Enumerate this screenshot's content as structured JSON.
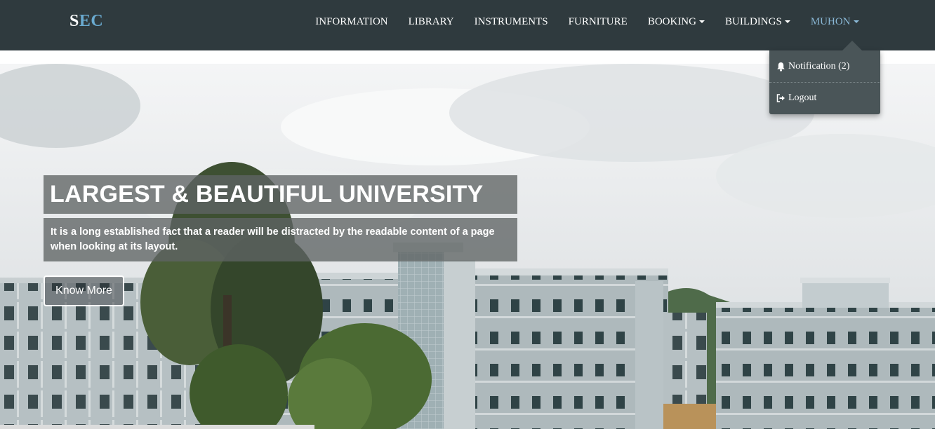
{
  "brand": {
    "part1": "S",
    "part2": "EC"
  },
  "nav": {
    "items": [
      {
        "label": "INFORMATION",
        "dropdown": false
      },
      {
        "label": "LIBRARY",
        "dropdown": false
      },
      {
        "label": "INSTRUMENTS",
        "dropdown": false
      },
      {
        "label": "FURNITURE",
        "dropdown": false
      },
      {
        "label": "BOOKING",
        "dropdown": true
      },
      {
        "label": "BUILDINGS",
        "dropdown": true
      },
      {
        "label": "MUHON",
        "dropdown": true,
        "active": true
      }
    ]
  },
  "user_menu": {
    "notification_label": "Notification (2)",
    "logout_label": "Logout",
    "notification_icon": "bell-icon",
    "logout_icon": "logout-icon"
  },
  "hero": {
    "headline": "LARGEST & BEAUTIFUL UNIVERSITY",
    "subtext": "It is a long established fact that a reader will be distracted by the readable content of a page when looking at its layout.",
    "button_label": "Know More"
  },
  "colors": {
    "navbar_bg": "#2f3a3e",
    "brand_accent": "#6aaad0",
    "active_nav": "#8ab8d6",
    "dropdown_bg": "#4a5558"
  }
}
